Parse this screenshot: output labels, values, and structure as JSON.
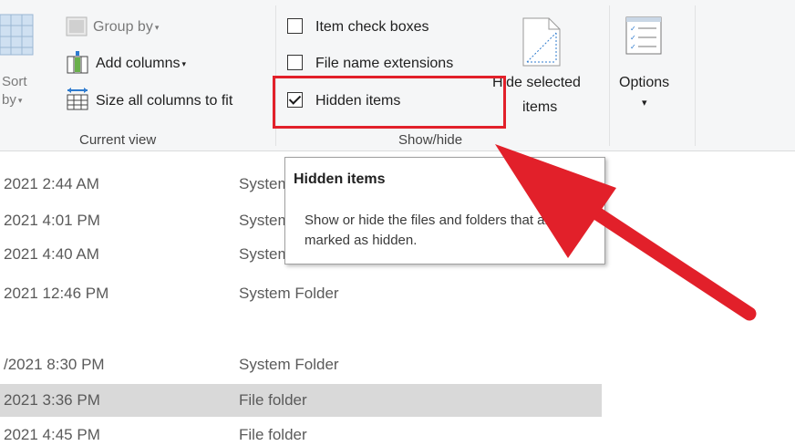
{
  "ribbon": {
    "sort": {
      "line1": "Sort",
      "line2": "by",
      "caret": "▾",
      "icon": "sort-icon"
    },
    "current_view": {
      "group_by": {
        "label": "Group by",
        "caret": "▾",
        "icon": "group-by-icon"
      },
      "add_columns": {
        "label": "Add columns",
        "caret": "▾",
        "icon": "add-columns-icon"
      },
      "size_columns": {
        "label": "Size all columns to fit",
        "icon": "size-columns-icon"
      },
      "group_label": "Current view"
    },
    "show_hide": {
      "item_check_boxes": {
        "label": "Item check boxes",
        "checked": false
      },
      "file_name_extensions": {
        "label": "File name extensions",
        "checked": false
      },
      "hidden_items": {
        "label": "Hidden items",
        "checked": true
      },
      "hide_selected": {
        "line1": "Hide selected",
        "line2": "items",
        "icon": "hide-selected-icon"
      },
      "group_label": "Show/hide"
    },
    "options": {
      "label": "Options",
      "caret": "▾",
      "icon": "options-icon"
    }
  },
  "tooltip": {
    "title": "Hidden items",
    "description": "Show or hide the files and folders that are marked as hidden."
  },
  "file_list": [
    {
      "date": "2021 2:44 AM",
      "type": "System Folder",
      "selected": false
    },
    {
      "date": "2021 4:01 PM",
      "type": "System Folder",
      "selected": false
    },
    {
      "date": "2021 4:40 AM",
      "type": "System Folder",
      "selected": false
    },
    {
      "date": "2021 12:46 PM",
      "type": "System Folder",
      "selected": false
    },
    {
      "date": "/2021 8:30 PM",
      "type": "System Folder",
      "selected": false
    },
    {
      "date": "2021 3:36 PM",
      "type": "File folder",
      "selected": true
    },
    {
      "date": "2021 4:45 PM",
      "type": "File folder",
      "selected": false
    }
  ],
  "colors": {
    "highlight": "#e2202a",
    "arrow": "#e2202a",
    "ribbon_bg": "#f5f6f7",
    "selected_row": "#d9d9d9"
  }
}
